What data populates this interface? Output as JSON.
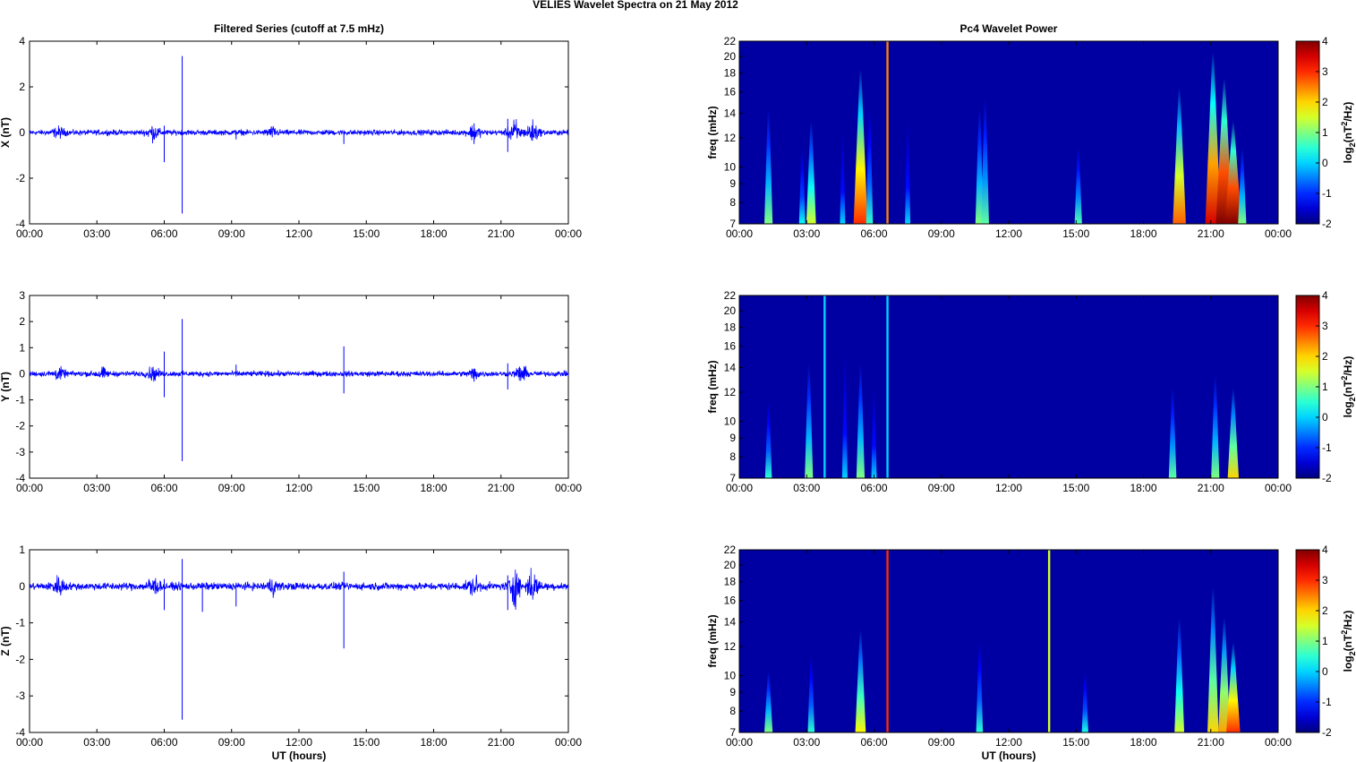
{
  "figure_title": "VELIES Wavelet Spectra on 21 May      2012",
  "chart_data": [
    {
      "type": "line",
      "title": "Filtered Series (cutoff at 7.5 mHz)",
      "ylabel": "X (nT)",
      "xlabel": "",
      "ylim": [
        -4,
        4
      ],
      "yticks": [
        "4",
        "2",
        "0",
        "-2",
        "-4"
      ],
      "xticks": [
        "00:00",
        "03:00",
        "06:00",
        "09:00",
        "12:00",
        "15:00",
        "18:00",
        "21:00",
        "00:00"
      ],
      "xlim_hours": [
        0,
        24
      ],
      "color": "#0000ff",
      "noise_amplitude": 0.08,
      "bursts": [
        [
          1.3,
          0.12
        ],
        [
          5.5,
          0.2
        ],
        [
          10.8,
          0.12
        ],
        [
          19.8,
          0.2
        ],
        [
          21.6,
          0.35
        ],
        [
          22.4,
          0.3
        ]
      ],
      "spikes": [
        [
          6.0,
          0.3,
          -1.3
        ],
        [
          6.8,
          3.35,
          -3.55
        ],
        [
          9.2,
          0.1,
          -0.3
        ],
        [
          14.0,
          0.1,
          -0.5
        ],
        [
          19.8,
          0.4,
          -0.5
        ],
        [
          21.3,
          0.6,
          -0.85
        ]
      ]
    },
    {
      "type": "line",
      "title": "",
      "ylabel": "Y (nT)",
      "xlabel": "",
      "ylim": [
        -4,
        3
      ],
      "yticks": [
        "3",
        "2",
        "1",
        "0",
        "-1",
        "-2",
        "-3",
        "-4"
      ],
      "xticks": [
        "00:00",
        "03:00",
        "06:00",
        "09:00",
        "12:00",
        "15:00",
        "18:00",
        "21:00",
        "00:00"
      ],
      "xlim_hours": [
        0,
        24
      ],
      "color": "#0000ff",
      "noise_amplitude": 0.07,
      "bursts": [
        [
          1.3,
          0.12
        ],
        [
          3.2,
          0.12
        ],
        [
          5.5,
          0.15
        ],
        [
          19.8,
          0.12
        ],
        [
          21.9,
          0.2
        ]
      ],
      "spikes": [
        [
          6.0,
          0.85,
          -0.9
        ],
        [
          6.8,
          2.1,
          -3.35
        ],
        [
          9.2,
          0.35,
          -0.1
        ],
        [
          14.0,
          1.05,
          -0.75
        ],
        [
          19.8,
          0.2,
          -0.3
        ],
        [
          21.3,
          0.4,
          -0.6
        ]
      ]
    },
    {
      "type": "line",
      "title": "",
      "ylabel": "Z (nT)",
      "xlabel": "UT (hours)",
      "ylim": [
        -4,
        1
      ],
      "yticks": [
        "1",
        "0",
        "-1",
        "-2",
        "-3",
        "-4"
      ],
      "xticks": [
        "00:00",
        "03:00",
        "06:00",
        "09:00",
        "12:00",
        "15:00",
        "18:00",
        "21:00",
        "00:00"
      ],
      "xlim_hours": [
        0,
        24
      ],
      "color": "#0000ff",
      "noise_amplitude": 0.07,
      "bursts": [
        [
          1.3,
          0.15
        ],
        [
          5.5,
          0.15
        ],
        [
          10.8,
          0.12
        ],
        [
          19.8,
          0.15
        ],
        [
          21.6,
          0.3
        ],
        [
          22.4,
          0.25
        ]
      ],
      "spikes": [
        [
          6.0,
          0.2,
          -0.65
        ],
        [
          6.8,
          0.75,
          -3.65
        ],
        [
          7.7,
          0.1,
          -0.7
        ],
        [
          9.2,
          0.1,
          -0.55
        ],
        [
          14.0,
          0.4,
          -1.7
        ],
        [
          21.3,
          0.3,
          -0.65
        ]
      ]
    },
    {
      "type": "heatmap",
      "title": "Pc4 Wavelet Power",
      "ylabel": "freq (mHz)",
      "xlabel": "",
      "ylim": [
        7,
        22
      ],
      "yscale": "log",
      "yticks": [
        "22",
        "20",
        "18",
        "16",
        "14",
        "12",
        "10",
        "9",
        "8",
        "7"
      ],
      "xticks": [
        "00:00",
        "03:00",
        "06:00",
        "09:00",
        "12:00",
        "15:00",
        "18:00",
        "21:00",
        "00:00"
      ],
      "colorbar": {
        "label": "log2(nT2/Hz)",
        "range": [
          -2,
          4
        ],
        "ticks": [
          "4",
          "3",
          "2",
          "1",
          "0",
          "-1",
          "-2"
        ]
      },
      "background_power": -1.8,
      "events": [
        [
          1.3,
          14,
          1
        ],
        [
          2.8,
          11,
          0.3
        ],
        [
          3.2,
          13,
          1.5
        ],
        [
          4.6,
          12,
          0
        ],
        [
          5.4,
          18,
          3
        ],
        [
          5.8,
          14,
          0.5
        ],
        [
          6.6,
          22,
          2.5
        ],
        [
          7.5,
          13,
          0
        ],
        [
          10.7,
          14,
          1
        ],
        [
          10.95,
          15,
          0.8
        ],
        [
          15.1,
          11,
          0.7
        ],
        [
          19.6,
          16,
          2.7
        ],
        [
          21.1,
          20,
          3.5
        ],
        [
          21.6,
          17,
          4
        ],
        [
          22.0,
          13,
          4
        ],
        [
          22.4,
          11,
          1
        ]
      ]
    },
    {
      "type": "heatmap",
      "title": "",
      "ylabel": "freq (mHz)",
      "xlabel": "",
      "ylim": [
        7,
        22
      ],
      "yscale": "log",
      "yticks": [
        "22",
        "20",
        "18",
        "16",
        "14",
        "12",
        "10",
        "9",
        "8",
        "7"
      ],
      "xticks": [
        "00:00",
        "03:00",
        "06:00",
        "09:00",
        "12:00",
        "15:00",
        "18:00",
        "21:00",
        "00:00"
      ],
      "colorbar": {
        "label": "log2(nT2/Hz)",
        "range": [
          -2,
          4
        ],
        "ticks": [
          "4",
          "3",
          "2",
          "1",
          "0",
          "-1",
          "-2"
        ]
      },
      "background_power": -1.8,
      "events": [
        [
          1.3,
          11,
          0.5
        ],
        [
          3.1,
          14,
          1
        ],
        [
          3.8,
          22,
          0
        ],
        [
          4.7,
          15,
          0
        ],
        [
          5.4,
          14,
          1
        ],
        [
          6.0,
          12,
          0
        ],
        [
          6.6,
          22,
          0
        ],
        [
          19.3,
          12,
          0.8
        ],
        [
          21.2,
          13,
          1
        ],
        [
          22.0,
          12,
          2
        ]
      ]
    },
    {
      "type": "heatmap",
      "title": "",
      "ylabel": "freq (mHz)",
      "xlabel": "UT (hours)",
      "ylim": [
        7,
        22
      ],
      "yscale": "log",
      "yticks": [
        "22",
        "20",
        "18",
        "16",
        "14",
        "12",
        "10",
        "9",
        "8",
        "7"
      ],
      "xticks": [
        "00:00",
        "03:00",
        "06:00",
        "09:00",
        "12:00",
        "15:00",
        "18:00",
        "21:00",
        "00:00"
      ],
      "colorbar": {
        "label": "log2(nT2/Hz)",
        "range": [
          -2,
          4
        ],
        "ticks": [
          "4",
          "3",
          "2",
          "1",
          "0",
          "-1",
          "-2"
        ]
      },
      "background_power": -1.8,
      "events": [
        [
          1.3,
          10,
          1
        ],
        [
          3.2,
          11,
          0.5
        ],
        [
          5.4,
          13,
          1.8
        ],
        [
          6.6,
          22,
          3
        ],
        [
          10.7,
          12,
          0.5
        ],
        [
          13.8,
          22,
          1.5
        ],
        [
          15.4,
          10,
          0.4
        ],
        [
          19.6,
          14,
          1.5
        ],
        [
          21.1,
          17,
          2
        ],
        [
          21.6,
          14,
          2.3
        ],
        [
          22.0,
          12,
          3
        ]
      ]
    }
  ]
}
